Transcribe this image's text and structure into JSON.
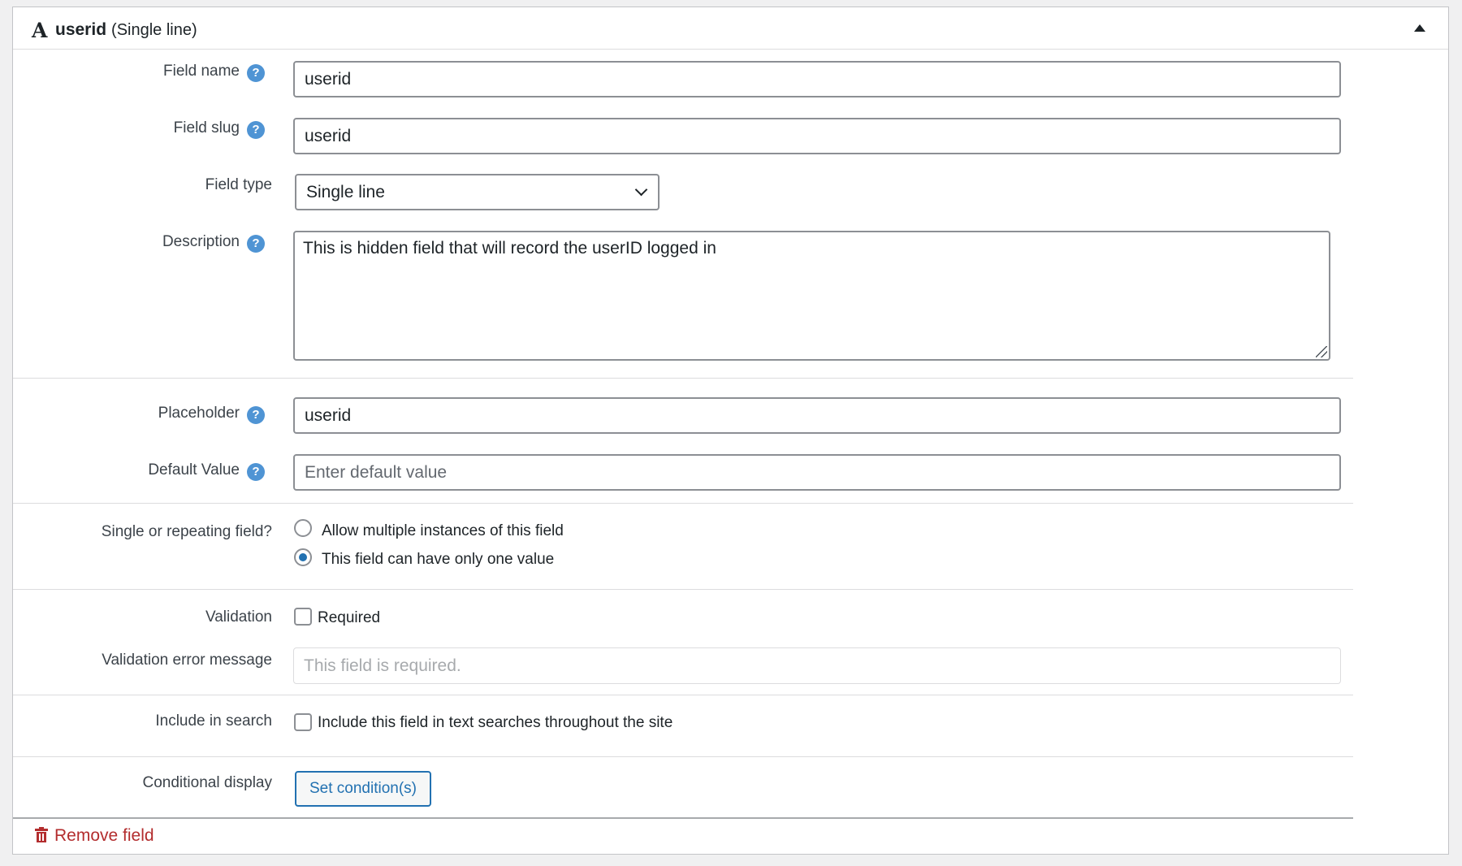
{
  "header": {
    "icon": "letter-a-icon",
    "field_name": "userid",
    "field_type": "(Single line)"
  },
  "fields": {
    "field_name": {
      "label": "Field name",
      "value": "userid"
    },
    "field_slug": {
      "label": "Field slug",
      "value": "userid"
    },
    "field_type": {
      "label": "Field type",
      "selected": "Single line"
    },
    "description": {
      "label": "Description",
      "value": "This is hidden field that will record the userID logged in"
    },
    "placeholder": {
      "label": "Placeholder",
      "value": "userid"
    },
    "default_value": {
      "label": "Default Value",
      "value": "",
      "placeholder": "Enter default value"
    },
    "repeating": {
      "label": "Single or repeating field?",
      "options": [
        "Allow multiple instances of this field",
        "This field can have only one value"
      ],
      "selected_index": 1
    },
    "validation": {
      "label": "Validation",
      "option": "Required",
      "checked": false
    },
    "validation_error": {
      "label": "Validation error message",
      "value": "",
      "placeholder": "This field is required."
    },
    "search": {
      "label": "Include in search",
      "option": "Include this field in text searches throughout the site",
      "checked": false
    },
    "conditional": {
      "label": "Conditional display",
      "button": "Set condition(s)"
    }
  },
  "help_icon": "?",
  "remove_label": "Remove field",
  "colors": {
    "accent": "#2271b1",
    "help": "#4f94d4",
    "danger": "#b32d2e"
  }
}
